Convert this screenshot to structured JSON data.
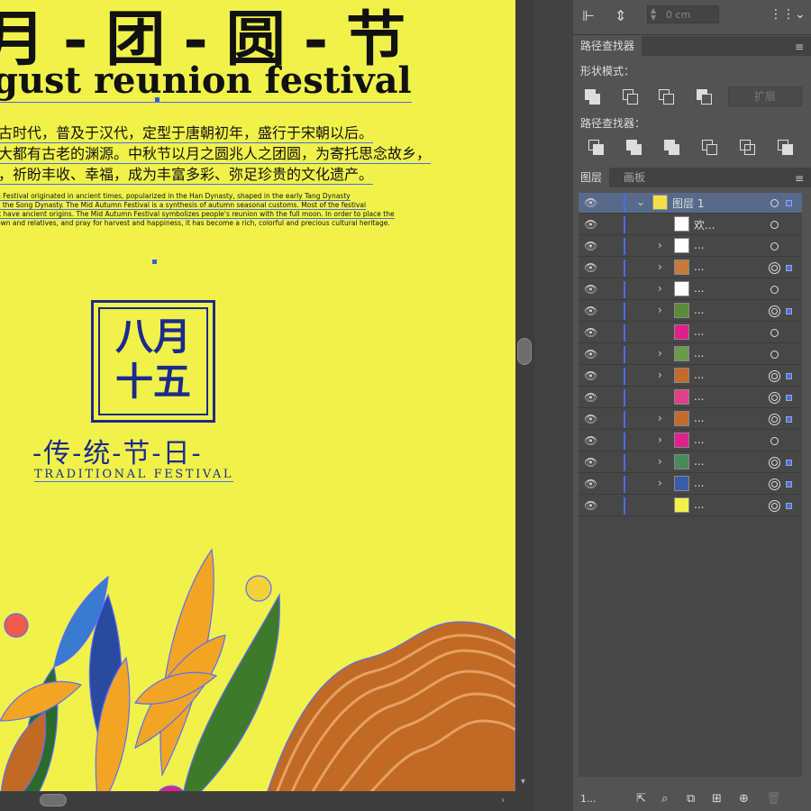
{
  "poster": {
    "title_cn": "月-团-圆-节",
    "title_en": "gust reunion festival",
    "cn_lines": [
      "古时代，普及于汉代，定型于唐朝初年，盛行于宋朝以后。",
      "大都有古老的渊源。中秋节以月之圆兆人之团圆，为寄托思念故乡，",
      "，祈盼丰收、幸福，成为丰富多彩、弥足珍贵的文化遗产。"
    ],
    "en_lines": [
      "n Festival originated in ancient times, popularized in the Han Dynasty, shaped in the early Tang Dynasty",
      "y the Song Dynasty. The Mid Autumn Festival is a synthesis of autumn seasonal customs. Most of the festival",
      "it have ancient origins. The Mid Autumn Festival symbolizes people's reunion with the full moon. In order to place the",
      "own and relatives, and pray for harvest and happiness, it has become a rich, colorful and precious cultural heritage."
    ],
    "stamp_line1": "八月",
    "stamp_line2": "十五",
    "trad_cn": "-传-统-节-日-",
    "trad_en": "TRADITIONAL FESTIVAL",
    "colors": {
      "background": "#f0f24a",
      "text": "#111111",
      "accent_blue": "#1c2a8c",
      "selection": "#4a6de8"
    }
  },
  "toolbar": {
    "width_value": "0 cm",
    "icons": [
      "align-left-icon",
      "distribute-icon",
      "grid-options-icon"
    ]
  },
  "pathfinder": {
    "tab": "路径查找器",
    "shape_modes_label": "形状模式：",
    "pathfinders_label": "路径查找器：",
    "expand_label": "扩展"
  },
  "layers": {
    "tab_layers": "图层",
    "tab_artboards": "画板",
    "footer_count": "1...",
    "rows": [
      {
        "name": "图层 1",
        "chevron": "down",
        "thumb": "#f3e04a",
        "target": "single",
        "selected": true
      },
      {
        "name": "欢...",
        "chevron": "",
        "thumb": "#ffffff",
        "target": "single",
        "selected": false
      },
      {
        "name": "...",
        "chevron": "right",
        "thumb": "#ffffff",
        "target": "single",
        "selected": false
      },
      {
        "name": "...",
        "chevron": "right",
        "thumb": "#c87a3a",
        "target": "double",
        "selected": true
      },
      {
        "name": "...",
        "chevron": "right",
        "thumb": "#ffffff",
        "target": "single",
        "selected": false
      },
      {
        "name": "...",
        "chevron": "right",
        "thumb": "#5a8a3a",
        "target": "double",
        "selected": true
      },
      {
        "name": "...",
        "chevron": "",
        "thumb": "#e0208a",
        "target": "single",
        "selected": false
      },
      {
        "name": "...",
        "chevron": "right",
        "thumb": "#6a9a4a",
        "target": "single",
        "selected": false
      },
      {
        "name": "...",
        "chevron": "right",
        "thumb": "#c46a2a",
        "target": "double",
        "selected": true
      },
      {
        "name": "...",
        "chevron": "",
        "thumb": "#e0408a",
        "target": "double",
        "selected": true
      },
      {
        "name": "...",
        "chevron": "right",
        "thumb": "#c46a2a",
        "target": "double",
        "selected": true
      },
      {
        "name": "...",
        "chevron": "right",
        "thumb": "#e02090",
        "target": "single",
        "selected": false
      },
      {
        "name": "...",
        "chevron": "right",
        "thumb": "#4a8a5a",
        "target": "double",
        "selected": true
      },
      {
        "name": "...",
        "chevron": "right",
        "thumb": "#3a5aaa",
        "target": "double",
        "selected": true
      },
      {
        "name": "...",
        "chevron": "",
        "thumb": "#f0f24a",
        "target": "double",
        "selected": true
      }
    ]
  }
}
